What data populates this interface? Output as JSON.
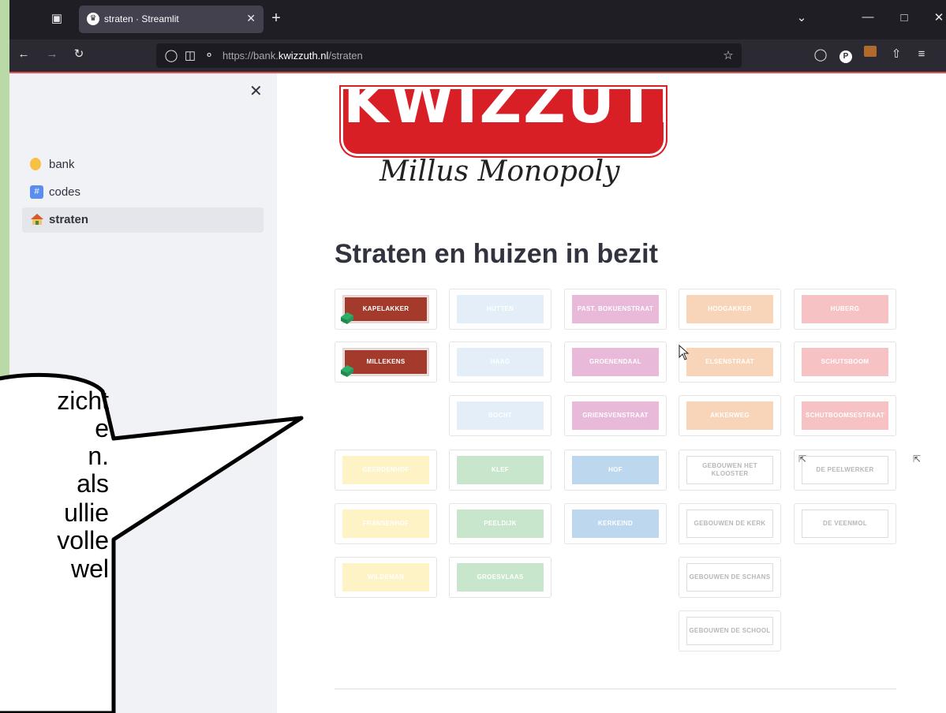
{
  "browser": {
    "tab_title": "straten · Streamlit",
    "url_prefix": "https://bank.",
    "url_host": "kwizzuth.nl",
    "url_path": "/straten"
  },
  "sidebar": {
    "items": [
      {
        "label": "bank",
        "icon": "lightbulb-icon",
        "active": false
      },
      {
        "label": "codes",
        "icon": "hash-icon",
        "active": false
      },
      {
        "label": "straten",
        "icon": "house-icon",
        "active": true
      }
    ]
  },
  "logo": {
    "text": "KWIZZUTH",
    "subtitle": "Millus Monopoly"
  },
  "page_title": "Straten en huizen in bezit",
  "colors": {
    "brown": "#a33a2c",
    "light_blue": "#e3eef8",
    "pink": "#e9b9d9",
    "orange": "#f8d5b8",
    "red": "#f6c2c4",
    "yellow": "#fdf3c4",
    "green": "#c8e6cc",
    "blue": "#bcd7ee",
    "white": "#ffffff"
  },
  "tiles": [
    {
      "label": "KAPELAKKER",
      "color": "brown",
      "owned": true
    },
    {
      "label": "HUTTEN",
      "color": "light_blue",
      "owned": false
    },
    {
      "label": "PAST. BOKUENSTRAAT",
      "color": "pink",
      "owned": false
    },
    {
      "label": "HOOGAKKER",
      "color": "orange",
      "owned": false
    },
    {
      "label": "HUBERG",
      "color": "red",
      "owned": false
    },
    {
      "label": "MILLEKENS",
      "color": "brown",
      "owned": true
    },
    {
      "label": "HAAG",
      "color": "light_blue",
      "owned": false
    },
    {
      "label": "GROENENDAAL",
      "color": "pink",
      "owned": false
    },
    {
      "label": "ELSENSTRAAT",
      "color": "orange",
      "owned": false
    },
    {
      "label": "SCHUTSBOOM",
      "color": "red",
      "owned": false
    },
    {
      "label": "BOCHT",
      "color": "light_blue",
      "owned": false
    },
    {
      "label": "GRIENSVENSTRAAT",
      "color": "pink",
      "owned": false
    },
    {
      "label": "AKKERWEG",
      "color": "orange",
      "owned": false
    },
    {
      "label": "SCHUTBOOMSESTRAAT",
      "color": "red",
      "owned": false
    },
    {
      "label": "GEERDENHOF",
      "color": "yellow",
      "owned": false
    },
    {
      "label": "KLEF",
      "color": "green",
      "owned": false
    },
    {
      "label": "HOF",
      "color": "blue",
      "owned": false
    },
    {
      "label": "GEBOUWEN HET KLOOSTER",
      "color": "white",
      "owned": false
    },
    {
      "label": "DE PEELWERKER",
      "color": "white",
      "owned": false
    },
    {
      "label": "FRANSENHOF",
      "color": "yellow",
      "owned": false
    },
    {
      "label": "PEELDIJK",
      "color": "green",
      "owned": false
    },
    {
      "label": "KERKEIND",
      "color": "blue",
      "owned": false
    },
    {
      "label": "GEBOUWEN DE KERK",
      "color": "white",
      "owned": false
    },
    {
      "label": "DE VEENMOL",
      "color": "white",
      "owned": false
    },
    {
      "label": "WILDEMAN",
      "color": "yellow",
      "owned": false
    },
    {
      "label": "GROESVLAAS",
      "color": "green",
      "owned": false
    },
    {
      "label": "GEBOUWEN DE SCHANS",
      "color": "white",
      "owned": false
    },
    {
      "label": "GEBOUWEN DE SCHOOL",
      "color": "white",
      "owned": false
    }
  ],
  "callout": {
    "lines": [
      "zicht",
      "e",
      "n.",
      "als",
      "ullie",
      "volle",
      "wel"
    ]
  }
}
